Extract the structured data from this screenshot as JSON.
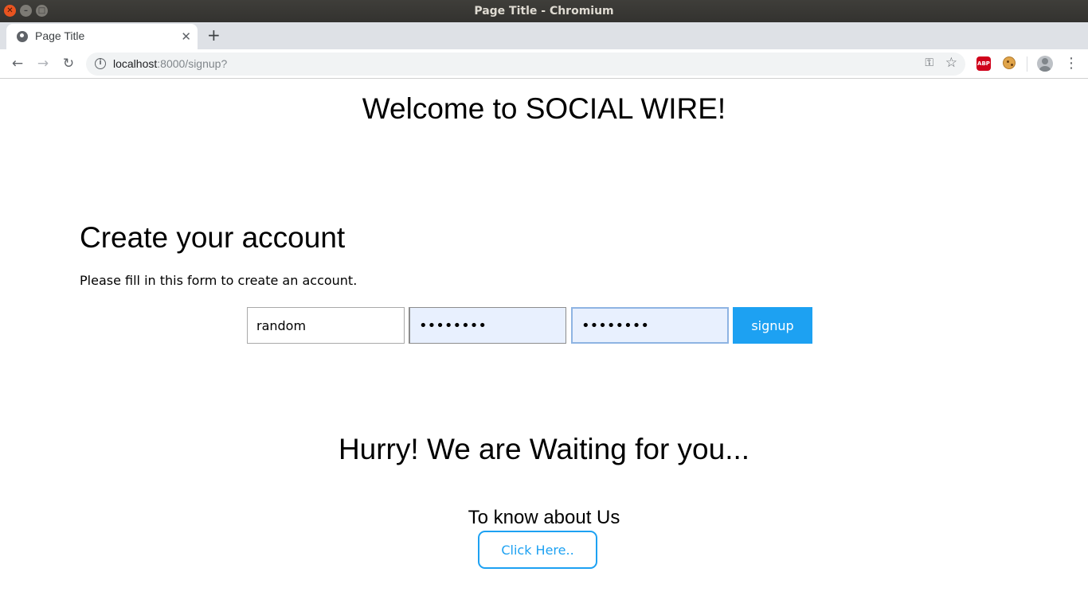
{
  "window": {
    "title": "Page Title - Chromium"
  },
  "tabs": [
    {
      "title": "Page Title",
      "active": true
    }
  ],
  "toolbar": {
    "url_host": "localhost",
    "url_rest": ":8000/signup?"
  },
  "page": {
    "welcome": "Welcome to SOCIAL WIRE!",
    "create_heading": "Create your account",
    "instructions": "Please fill in this form to create an account.",
    "form": {
      "username_value": "random",
      "password_value": "••••••••",
      "confirm_value": "••••••••",
      "signup_label": "signup"
    },
    "hurry": "Hurry! We are Waiting for you...",
    "know_about": "To know about Us",
    "click_label": "Click Here.."
  },
  "colors": {
    "accent": "#1da1f2",
    "autofill_bg": "#e8f0fe"
  }
}
